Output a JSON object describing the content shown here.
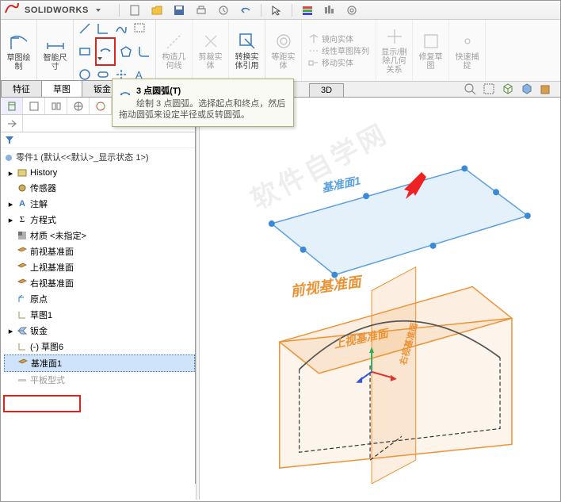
{
  "app": {
    "name": "SOLIDWORKS"
  },
  "ribbon": {
    "sketch_draw": "草图绘制",
    "smart_dim": "智能尺寸",
    "build_geom": "构造几何线",
    "trim": "剪裁实体",
    "convert": "转换实体引用",
    "offset": "等距实体",
    "mirror": "镜向实体",
    "pattern": "线性草图阵列",
    "move": "移动实体",
    "show": "显示/删除几何关系",
    "fix": "修复草图",
    "quick": "快速捕捉"
  },
  "tabs": {
    "t1": "特征",
    "t2": "草图",
    "t3": "钣金",
    "t4": "3D"
  },
  "tooltip": {
    "title": "3 点圆弧(T)",
    "body": "绘制 3 点圆弧。选择起点和终点，然后拖动圆弧来设定半径或反转圆弧。"
  },
  "tree": {
    "root": "零件1  (默认<<默认>_显示状态 1>)",
    "items": [
      "History",
      "传感器",
      "注解",
      "方程式",
      "材质 <未指定>",
      "前视基准面",
      "上视基准面",
      "右视基准面",
      "原点",
      "草图1",
      "钣金",
      "(-) 草图6",
      "基准面1",
      "平板型式"
    ]
  },
  "viewport": {
    "plane1": "基准面1",
    "front": "前视基准面",
    "top": "上视基准面",
    "right": "右视基准面",
    "watermark": "软件自学网"
  }
}
